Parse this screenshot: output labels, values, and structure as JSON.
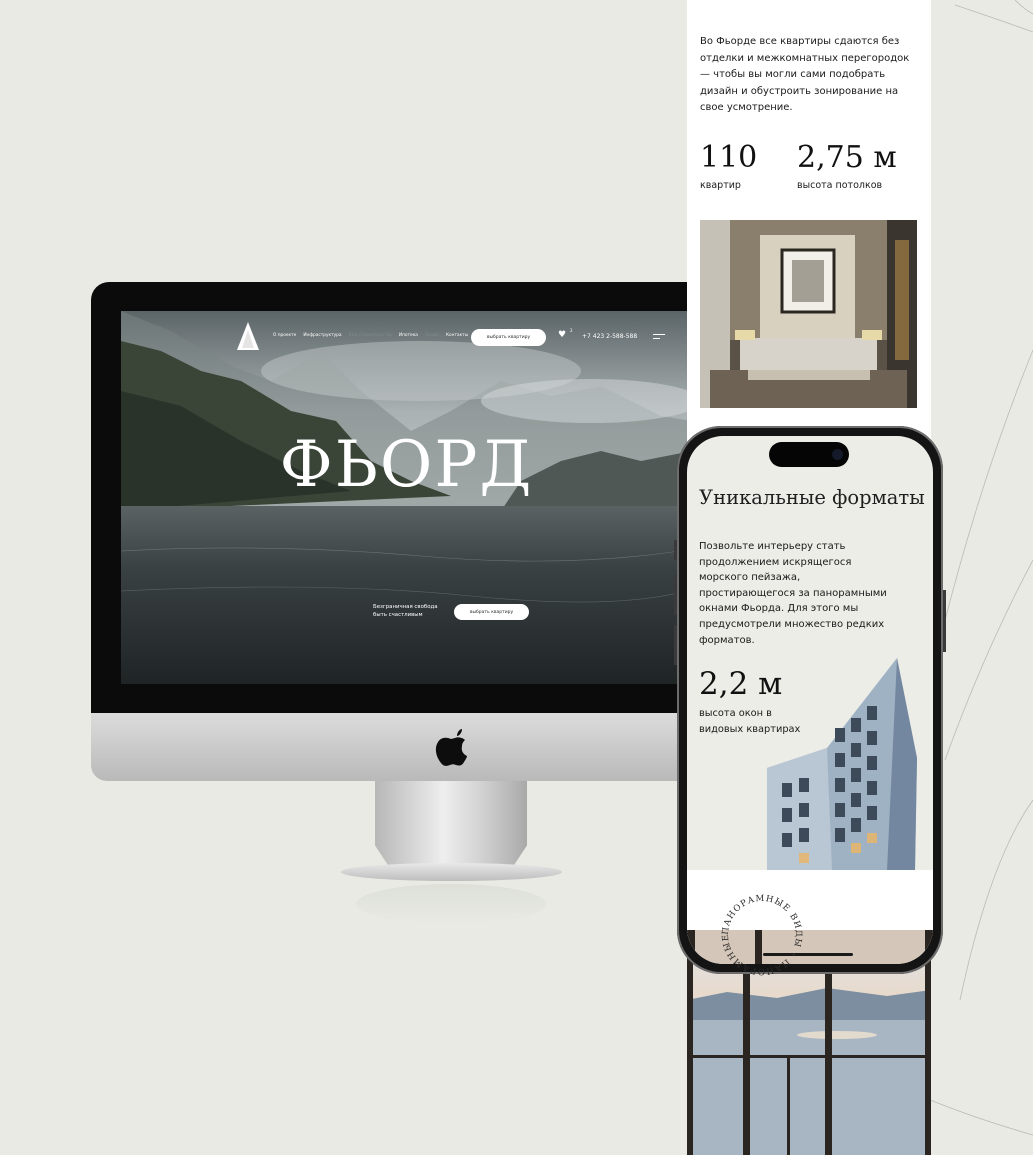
{
  "desktop_site": {
    "nav": {
      "links": [
        {
          "label": "О проекте",
          "dim": false
        },
        {
          "label": "Инфраструктура",
          "dim": false
        },
        {
          "label": "Ход строительства",
          "dim": true
        },
        {
          "label": "Ипотека",
          "dim": false
        },
        {
          "label": "Акции",
          "dim": true
        },
        {
          "label": "Контакты",
          "dim": false
        }
      ],
      "cta": "выбрать квартиру",
      "favorites_count": "2",
      "phone": "+7 423 2-588-588"
    },
    "hero": {
      "title": "ФЬОРД",
      "tagline": "Безграничная свобода быть счастливым",
      "cta": "выбрать квартиру"
    }
  },
  "page_strip": {
    "intro": "Во Фьорде все квартиры сдаются без отделки и межкомнатных перегородок — чтобы вы могли сами подобрать дизайн и обустроить зонирование на свое усмотрение.",
    "stats": [
      {
        "value": "110",
        "label": "квартир"
      },
      {
        "value": "2,75 м",
        "label": "высота потолков"
      }
    ]
  },
  "phone": {
    "title": "Уникальные форматы",
    "body": "Позвольте интерьеру стать продолжением искрящегося морского пейзажа, простирающегося за панорамными окнами Фьорда. Для этого мы предусмотрели множество редких форматов.",
    "stat_value": "2,2 м",
    "stat_label": "высота окон в видовых квартирах",
    "stamp_text": "ПАНОРАМНЫЕ ВИДЫ • ПАНОРАМНЫЕ ВИДЫ •"
  },
  "colors": {
    "background": "#e8eae3",
    "phone_screen": "#ecede6",
    "cta_bg": "#ffffff"
  },
  "icons": [
    "fjord-logo-icon",
    "heart-icon",
    "burger-menu-icon",
    "apple-logo-icon"
  ]
}
